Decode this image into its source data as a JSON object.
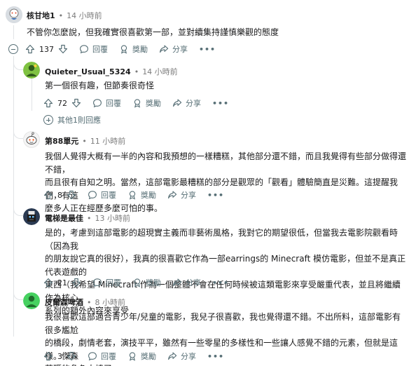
{
  "actions": {
    "reply": "回覆",
    "award": "獎勵",
    "share": "分享"
  },
  "comments": [
    {
      "author": "核甘地1",
      "time": "14 小時前",
      "body": "不管你怎麼說，但我確實很喜歡第一部，並對續集持謹慎樂觀的態度",
      "votes": "137"
    },
    {
      "author": "Quieter_Usual_5324",
      "time": "14 小時前",
      "body": "第一個很有趣，但節奏很奇怪",
      "votes": "72",
      "more_replies": "其他1則回應"
    },
    {
      "author": "第88單元",
      "time": "11 小時前",
      "body": "我個人覺得大概有一半的內容和我預想的一樣糟糕，其他部分還不錯，而且我覺得有些部分做得還不錯，\n而且很有自知之明。當然，這部電影最糟糕的部分是觀眾的「觀看」體驗簡直是災難。這提醒我們，有這\n麼多人正在經歷多麼可怕的事。",
      "votes": "8"
    },
    {
      "author": "電梯是最佳",
      "time": "13 小時前",
      "body": "是的，考慮到這部電影的超現實主義而非藝術風格，我對它的期望很低，但當我去電影院觀看時（因為我\n的朋友說它真的很好），我真的很喜歡它作為一部earrings的 Minecraft 模仿電影，但並不是真正代表遊戲的\n東西（我希望 Minecraft 作為一個整體不會在任何時候被這類電影來享受嚴重代表，並且將繼續作為核心\n系列的額外內容來享受",
      "votes": "21"
    },
    {
      "author": "皮爾森啤酒",
      "time": "8 小時前",
      "body": "我很喜歡這部適合青少年/兒童的電影，我兒子很喜歡，我也覺得還不錯。不出所料，這部電影有很多尷尬\n的橋段，劇情老套，演技平平，雖然有一些零星的多樣性和一些讓人感覺不錯的元素，但就是這樣。傑森\n莫瑪的角色太棒了。",
      "votes": "3"
    }
  ]
}
